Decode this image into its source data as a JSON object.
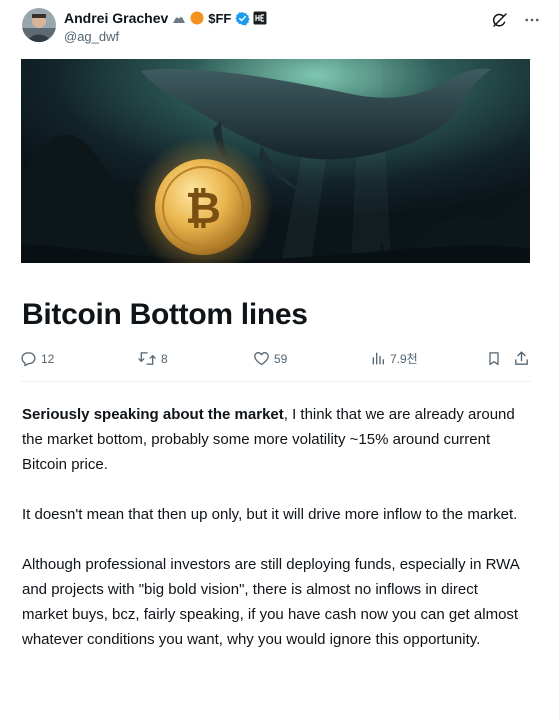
{
  "author": {
    "display_name": "Andrei Grachev",
    "token_tag": "$FF",
    "handle": "@ag_dwf"
  },
  "article": {
    "title": "Bitcoin Bottom lines",
    "paragraphs": [
      {
        "bold_lead": "Seriously speaking about the market",
        "text": ", I think that we are already around the market bottom, probably some more volatility ~15% around current Bitcoin price."
      },
      {
        "bold_lead": "",
        "text": "It doesn't mean that then up only, but it will drive more inflow to the market."
      },
      {
        "bold_lead": "",
        "text": "Although professional investors are still deploying funds, especially in RWA and projects with \"big bold vision\", there is almost no inflows in direct market buys, bcz, fairly speaking, if you have cash now you can get almost whatever conditions you want, why you would ignore this opportunity."
      }
    ]
  },
  "metrics": {
    "replies": "12",
    "reposts": "8",
    "likes": "59",
    "views": "7.9천"
  },
  "icons": {
    "reply": "reply-icon",
    "repost": "repost-icon",
    "like": "heart-icon",
    "views": "analytics-icon",
    "bookmark": "bookmark-icon",
    "share": "share-icon",
    "grok": "grok-icon",
    "more": "more-icon",
    "verified": "verified-badge-icon"
  },
  "colors": {
    "text": "#0f1419",
    "muted": "#536471",
    "verified": "#1d9bf0",
    "divider": "#eff3f4",
    "coin_gold": "#e9b44c"
  }
}
